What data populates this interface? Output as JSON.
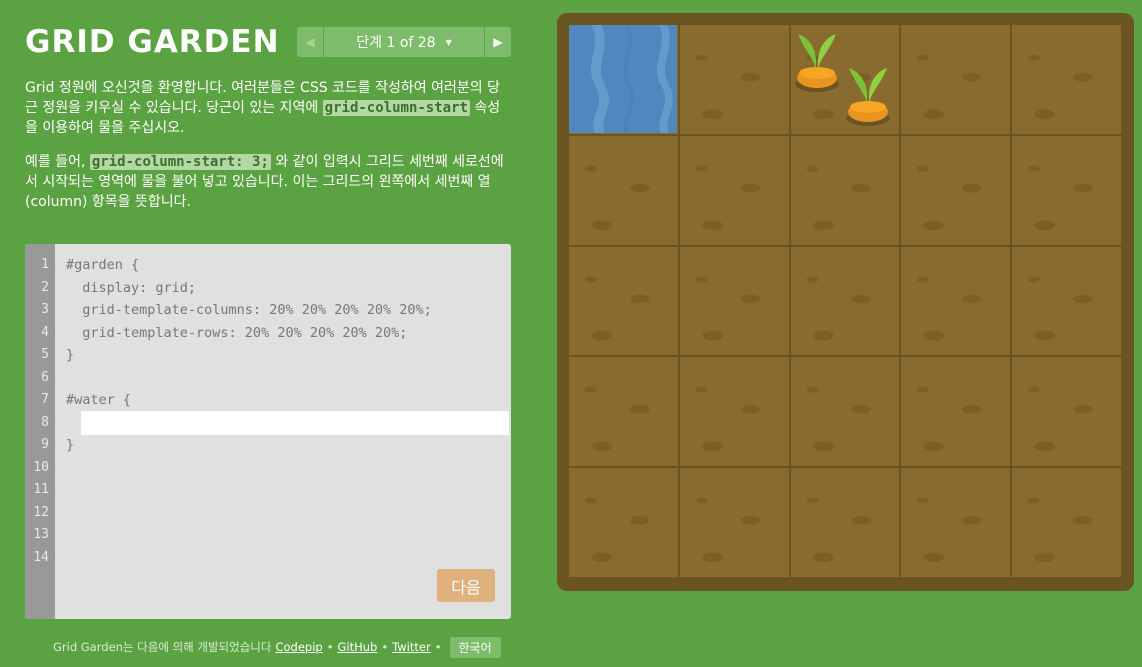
{
  "app": {
    "title": "GRID GARDEN"
  },
  "level_nav": {
    "prev_icon": "chevron-left-icon",
    "label": "단계 1 of 28",
    "caret_icon": "caret-down-icon",
    "next_icon": "chevron-right-icon"
  },
  "instructions": {
    "p1_part1": "Grid 정원에 오신것을 환영합니다. 여러분들은 CSS 코드를 작성하여 여러분의 당근 정원을 키우실 수 있습니다. 당근이 있는 지역에 ",
    "p1_code": "grid-column-start",
    "p1_part2": " 속성을 이용하여 물을 주십시오.",
    "p2_part1": "예를 들어, ",
    "p2_code": "grid-column-start: 3;",
    "p2_part2": " 와 같이 입력시 그리드 세번째 세로선에서 시작되는 영역에 물을 불어 넣고 있습니다. 이는 그리드의 왼쪽에서 세번째 열(column) 항목을 뜻합니다."
  },
  "editor": {
    "line_numbers": [
      "1",
      "2",
      "3",
      "4",
      "5",
      "6",
      "7",
      "8",
      "9",
      "10",
      "11",
      "12",
      "13",
      "14"
    ],
    "lines": {
      "l1": "#garden {",
      "l2": "  display: grid;",
      "l3": "  grid-template-columns: 20% 20% 20% 20% 20%;",
      "l4": "  grid-template-rows: 20% 20% 20% 20% 20%;",
      "l5": "}",
      "l7": "#water {",
      "l9": "}"
    },
    "input_value": "",
    "next_label": "다음"
  },
  "footer": {
    "credit": "Grid Garden는 다음에 의해 개발되었습니다",
    "links": [
      "Codepip",
      "GitHub",
      "Twitter"
    ],
    "separator": "•",
    "language": "한국어"
  },
  "colors": {
    "background": "#5ba342",
    "soil": "#8a6b2f",
    "frame": "#6a5422",
    "water": "#4f88bf",
    "next_button": "#deb17d"
  }
}
